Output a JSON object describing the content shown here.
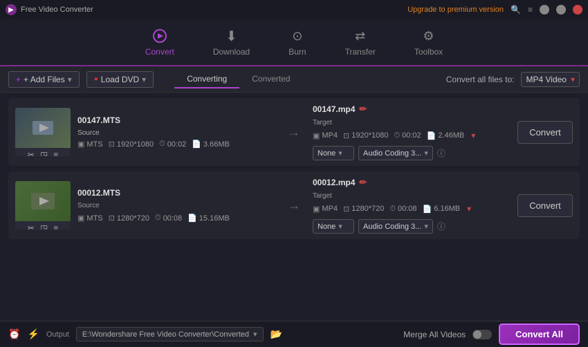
{
  "titlebar": {
    "app_name": "Free Video Converter",
    "upgrade_text": "Upgrade to premium version",
    "logo_icon": "▶"
  },
  "navbar": {
    "items": [
      {
        "id": "convert",
        "label": "Convert",
        "icon": "↕",
        "active": true
      },
      {
        "id": "download",
        "label": "Download",
        "icon": "⬇",
        "active": false
      },
      {
        "id": "burn",
        "label": "Burn",
        "icon": "⊙",
        "active": false
      },
      {
        "id": "transfer",
        "label": "Transfer",
        "icon": "⇄",
        "active": false
      },
      {
        "id": "toolbox",
        "label": "Toolbox",
        "icon": "⚙",
        "active": false
      }
    ]
  },
  "toolbar": {
    "add_files_label": "+ Add Files",
    "load_dvd_label": "Load DVD",
    "tab_converting": "Converting",
    "tab_converted": "Converted",
    "convert_all_label": "Convert all files to:",
    "format_value": "MP4 Video"
  },
  "files": [
    {
      "source_name": "00147.MTS",
      "target_name": "00147.mp4",
      "source_format": "MTS",
      "source_res": "1920*1080",
      "source_time": "00:02",
      "source_size": "3.66MB",
      "target_format": "MP4",
      "target_res": "1920*1080",
      "target_time": "00:02",
      "target_size": "2.46MB",
      "audio_preset": "None",
      "audio_coding": "Audio Coding 3...",
      "convert_label": "Convert",
      "thumb_class": "thumb-img1"
    },
    {
      "source_name": "00012.MTS",
      "target_name": "00012.mp4",
      "source_format": "MTS",
      "source_res": "1280*720",
      "source_time": "00:08",
      "source_size": "15.16MB",
      "target_format": "MP4",
      "target_res": "1280*720",
      "target_time": "00:08",
      "target_size": "6.16MB",
      "audio_preset": "None",
      "audio_coding": "Audio Coding 3...",
      "convert_label": "Convert",
      "thumb_class": "thumb-img2"
    }
  ],
  "statusbar": {
    "output_label": "Output",
    "output_path": "E:\\Wondershare Free Video Converter\\Converted",
    "merge_label": "Merge All Videos",
    "convert_all_btn": "Convert All"
  }
}
